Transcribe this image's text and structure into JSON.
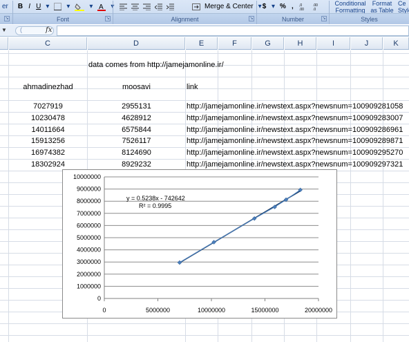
{
  "ribbon": {
    "left_fragment": "er",
    "font_buttons": [
      "B",
      "I",
      "U"
    ],
    "font_group": "Font",
    "alignment_group": "Alignment",
    "merge_center": "Merge & Center",
    "number_group": "Number",
    "currency": "$",
    "percent": "%",
    "comma": ",",
    "conditional_formatting": "Conditional Formatting",
    "format_as_table": "Format as Table",
    "cell_styles": "Ce Style",
    "styles_group": "Styles",
    "fx_label": "fx"
  },
  "columns": [
    "C",
    "D",
    "E",
    "F",
    "G",
    "H",
    "I",
    "J",
    "K"
  ],
  "sheet": {
    "source_note": "data comes from http://jamejamonline.ir/",
    "headers": {
      "c": "ahmadinezhad",
      "d": "moosavi",
      "e": "link"
    },
    "rows": [
      {
        "c": "7027919",
        "d": "2955131",
        "e": "http://jamejamonline.ir/newstext.aspx?newsnum=100909281058"
      },
      {
        "c": "10230478",
        "d": "4628912",
        "e": "http://jamejamonline.ir/newstext.aspx?newsnum=100909283007"
      },
      {
        "c": "14011664",
        "d": "6575844",
        "e": "http://jamejamonline.ir/newstext.aspx?newsnum=100909286961"
      },
      {
        "c": "15913256",
        "d": "7526117",
        "e": "http://jamejamonline.ir/newstext.aspx?newsnum=100909289871"
      },
      {
        "c": "16974382",
        "d": "8124690",
        "e": "http://jamejamonline.ir/newstext.aspx?newsnum=100909295270"
      },
      {
        "c": "18302924",
        "d": "8929232",
        "e": "http://jamejamonline.ir/newstext.aspx?newsnum=100909297321"
      }
    ]
  },
  "chart_data": {
    "type": "scatter",
    "x": [
      7027919,
      10230478,
      14011664,
      15913256,
      16974382,
      18302924
    ],
    "y": [
      2955131,
      4628912,
      6575844,
      7526117,
      8124690,
      8929232
    ],
    "xlim": [
      0,
      20000000
    ],
    "ylim": [
      0,
      10000000
    ],
    "x_ticks": [
      "0",
      "5000000",
      "10000000",
      "15000000",
      "20000000"
    ],
    "y_ticks": [
      "0",
      "1000000",
      "2000000",
      "3000000",
      "4000000",
      "5000000",
      "6000000",
      "7000000",
      "8000000",
      "9000000",
      "10000000"
    ],
    "trendline_equation": "y = 0.5238x - 742642",
    "r_squared": "R² = 0.9995",
    "trendline": {
      "slope": 0.5238,
      "intercept": -742642
    },
    "grid": "horizontal",
    "marker_color": "#4a7ebb",
    "line_color": "#17375e"
  }
}
